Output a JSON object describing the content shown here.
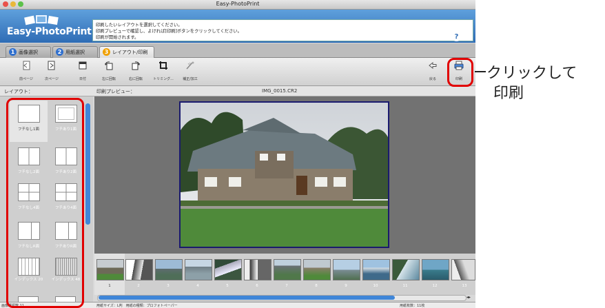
{
  "window": {
    "title": "Easy-PhotoPrint",
    "traffic_lights": {
      "close": "#e9524a",
      "minimize": "#e9b83a",
      "zoom": "#5cc14a"
    }
  },
  "header": {
    "logo_text": "Easy-PhotoPrint",
    "message_lines": [
      "印刷したいレイアウトを選択してください。",
      "印刷プレビューで確認し、よければ[印刷]ボタンをクリックしてください。",
      "印刷が開始されます。"
    ],
    "exif_logo": "Exif Print",
    "help_glyph": "?",
    "collapse_glyph": "≡"
  },
  "tabs": [
    {
      "number": "1",
      "label": "画像選択",
      "color": "#2f6fce",
      "active": false
    },
    {
      "number": "2",
      "label": "用紙選択",
      "color": "#2f6fce",
      "active": false
    },
    {
      "number": "3",
      "label": "レイアウト/印刷",
      "color": "#f0a000",
      "active": true
    }
  ],
  "toolbar": {
    "buttons": [
      {
        "label": "前ページ",
        "icon": "page-prev-icon"
      },
      {
        "label": "次ページ",
        "icon": "page-next-icon"
      },
      {
        "label": "日付",
        "icon": "date-icon"
      },
      {
        "label": "左に回転",
        "icon": "rotate-left-icon"
      },
      {
        "label": "右に回転",
        "icon": "rotate-right-icon"
      },
      {
        "label": "トリミング...",
        "icon": "crop-icon"
      },
      {
        "label": "補正/加工",
        "icon": "correction-icon"
      }
    ],
    "back_label": "戻る",
    "print_label": "印刷"
  },
  "subheader": {
    "layout_label": "レイアウト：",
    "preview_label": "印刷プレビュー：",
    "filename": "IMG_0015.CR2"
  },
  "layouts": [
    {
      "label": "フチなし1面"
    },
    {
      "label": "フチあり1面"
    },
    {
      "label": "フチなし2面"
    },
    {
      "label": "フチあり2面"
    },
    {
      "label": "フチなし4面"
    },
    {
      "label": "フチあり4面"
    },
    {
      "label": "フチなしR面"
    },
    {
      "label": "フチありR面"
    },
    {
      "label": "インデックス 20"
    },
    {
      "label": "インデックス 48"
    }
  ],
  "filmstrip": {
    "numbers": [
      "1",
      "2",
      "3",
      "4",
      "5",
      "6",
      "7",
      "8",
      "9",
      "10",
      "11",
      "12",
      "13"
    ]
  },
  "statusbar": {
    "left": "画像選択数 11",
    "middle": "用紙サイズ：L判　用紙の種類：プロフォトペーパー",
    "right": "用紙枚数：11枚"
  },
  "annotation": {
    "line1": "クリックして",
    "line2": "印刷"
  }
}
